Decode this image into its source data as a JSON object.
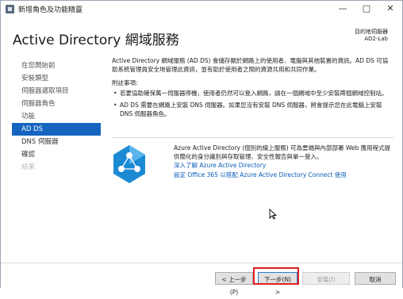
{
  "window": {
    "title": "新增角色及功能精靈",
    "minimize": "—",
    "maximize": "□",
    "close": "✕"
  },
  "header": {
    "title": "Active Directory 網域服務",
    "dest_label": "目的地伺服器",
    "dest_server": "AD2-Lab"
  },
  "nav": {
    "items": [
      {
        "label": "在您開始前",
        "state": "normal"
      },
      {
        "label": "安裝類型",
        "state": "normal"
      },
      {
        "label": "伺服器選取項目",
        "state": "normal"
      },
      {
        "label": "伺服器角色",
        "state": "normal"
      },
      {
        "label": "功能",
        "state": "normal"
      },
      {
        "label": "AD DS",
        "state": "active"
      },
      {
        "label": "DNS 伺服器",
        "state": "normal"
      },
      {
        "label": "確認",
        "state": "normal"
      },
      {
        "label": "結果",
        "state": "disabled"
      }
    ]
  },
  "content": {
    "intro": "Active Directory 網域服務 (AD DS) 會儲存關於網路上的使用者、電腦與其他裝置的資訊。AD DS 可協助系統管理員安全地管理此資訊，並有助於使用者之間的資源共用和共同作業。",
    "notes_title": "附註事項:",
    "notes": [
      "若要協助確保萬一伺服器停機，使用者仍然可以登入網路，請在一個網域中至少安裝兩個網域控制站。",
      "AD DS 需要在網路上安裝 DNS 伺服器。如果您沒有安裝 DNS 伺服器，將會提示您在此電腦上安裝 DNS 伺服器角色。"
    ]
  },
  "azure": {
    "text": "Azure Active Directory (個別的線上服務) 可為雲端與內部部署 Web 應用程式提供簡化的身分識別與存取管理、安全性報告與單一登入。",
    "link1": "深入了解 Azure Active Directory",
    "link2": "設定 Office 365 以搭配 Azure Active Directory Connect 使用",
    "logo_color": "#1b8ad3"
  },
  "footer": {
    "prev": "< 上一步(P)",
    "next": "下一步(N) >",
    "install": "安裝(I)",
    "cancel": "取消",
    "highlight_color": "#e02020"
  }
}
